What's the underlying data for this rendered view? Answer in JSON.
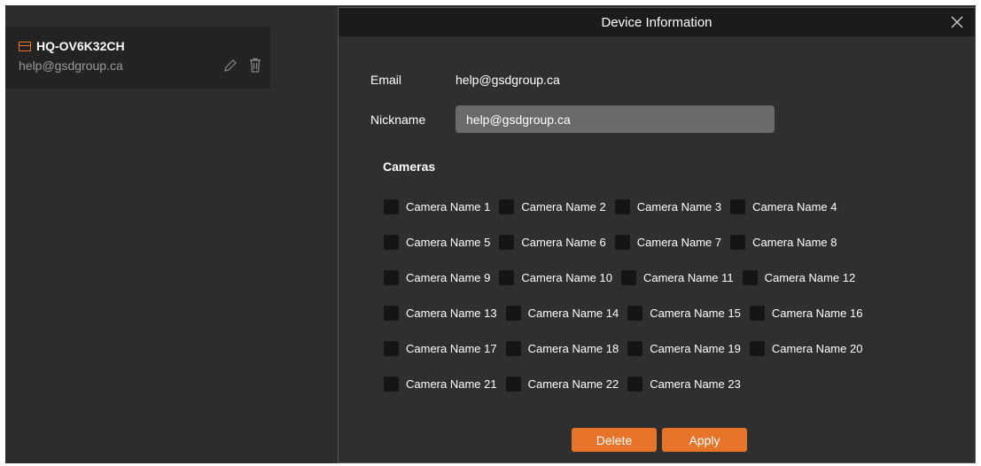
{
  "device": {
    "name": "HQ-OV6K32CH",
    "email": "help@gsdgroup.ca"
  },
  "modal": {
    "title": "Device Information",
    "email_label": "Email",
    "email_value": "help@gsdgroup.ca",
    "nickname_label": "Nickname",
    "nickname_value": "help@gsdgroup.ca",
    "cameras_label": "Cameras",
    "cameras": [
      "Camera Name 1",
      "Camera Name 2",
      "Camera Name 3",
      "Camera Name 4",
      "Camera Name 5",
      "Camera Name 6",
      "Camera Name 7",
      "Camera Name 8",
      "Camera Name 9",
      "Camera Name 10",
      "Camera Name 11",
      "Camera Name 12",
      "Camera Name 13",
      "Camera Name 14",
      "Camera Name 15",
      "Camera Name 16",
      "Camera Name 17",
      "Camera Name 18",
      "Camera Name 19",
      "Camera Name 20",
      "Camera Name 21",
      "Camera Name 22",
      "Camera Name 23"
    ],
    "delete_label": "Delete",
    "apply_label": "Apply"
  },
  "colors": {
    "accent": "#e8742a",
    "panel": "#2d2d2d",
    "header": "#1b1b1b"
  }
}
